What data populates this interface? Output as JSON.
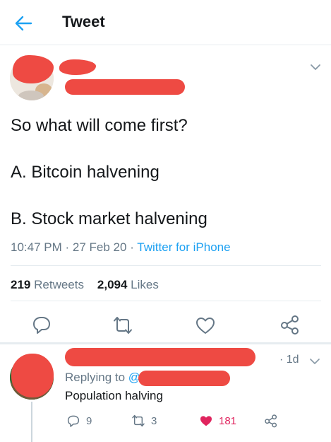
{
  "header": {
    "title": "Tweet",
    "back_icon": "arrow-left-icon",
    "accent": "#1da1f2"
  },
  "tweet": {
    "lines": [
      "So what will come first?",
      "A. Bitcoin halvening",
      "B. Stock market halvening"
    ],
    "time": "10:47 PM",
    "date": "27 Feb 20",
    "separator": "·",
    "source": "Twitter for iPhone",
    "retweets_count": "219",
    "retweets_label": "Retweets",
    "likes_count": "2,094",
    "likes_label": "Likes"
  },
  "reply": {
    "age": "· 1d",
    "replying_prefix": "Replying to",
    "replying_handle": "@",
    "text": "Population halving",
    "reply_count": "9",
    "retweet_count": "3",
    "like_count": "181",
    "like_color": "#e0245e"
  },
  "colors": {
    "text": "#14171a",
    "secondary": "#657786",
    "link": "#1da1f2",
    "divider": "#e6ecf0",
    "redaction": "#ee4a43"
  }
}
